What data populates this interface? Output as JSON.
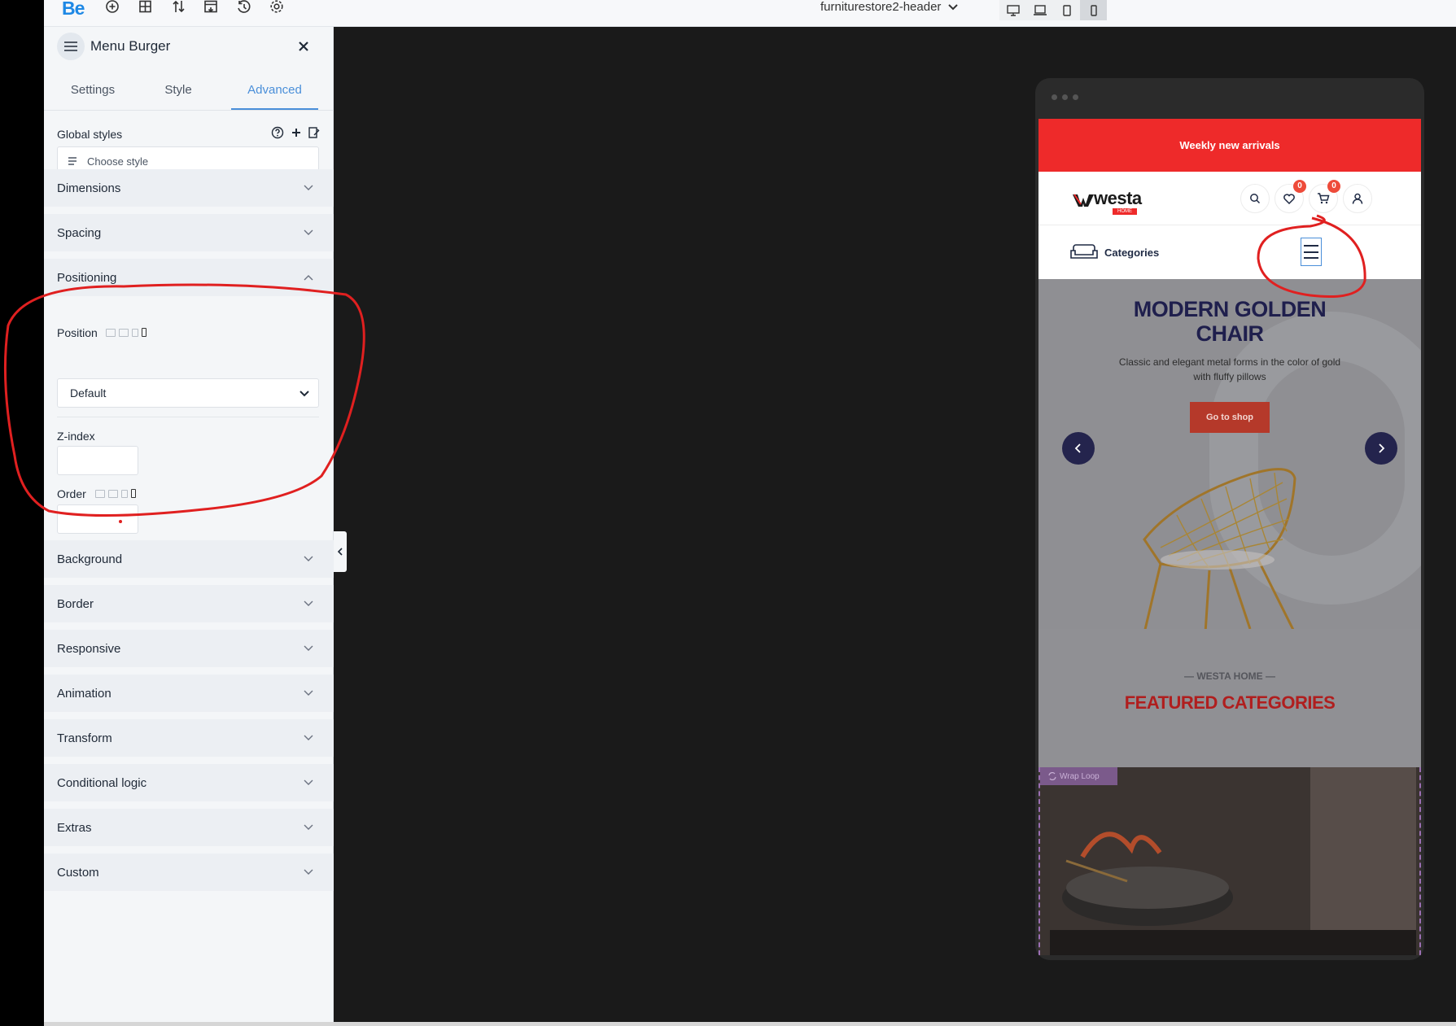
{
  "topbar": {
    "logo": "Be",
    "icons": [
      "plus-circle-icon",
      "layout-add-icon",
      "sort-icon",
      "template-icon",
      "history-icon",
      "gear-icon"
    ],
    "doc_title": "furniturestore2-header",
    "devices": [
      "desktop-icon",
      "laptop-icon",
      "tablet-icon",
      "mobile-icon"
    ],
    "active_device": "mobile"
  },
  "sidebar": {
    "title": "Menu Burger",
    "tabs": [
      "Settings",
      "Style",
      "Advanced"
    ],
    "active_tab": "Advanced",
    "global_styles": {
      "label": "Global styles",
      "placeholder": "Choose style"
    },
    "sections": {
      "dimensions": "Dimensions",
      "spacing": "Spacing",
      "positioning": "Positioning",
      "background": "Background",
      "border": "Border",
      "responsive": "Responsive",
      "animation": "Animation",
      "transform": "Transform",
      "conditional_logic": "Conditional logic",
      "extras": "Extras",
      "custom": "Custom"
    },
    "positioning": {
      "position_label": "Position",
      "position_value": "Default",
      "zindex_label": "Z-index",
      "zindex_value": "",
      "order_label": "Order",
      "order_value": ""
    }
  },
  "preview": {
    "announcement": "Weekly new arrivals",
    "brand": "westa",
    "brand_sub": "HOME",
    "wishlist_count": "0",
    "cart_count": "0",
    "categories_label": "Categories",
    "hero": {
      "title_line1": "MODERN GOLDEN",
      "title_line2": "CHAIR",
      "description": "Classic and elegant metal forms in the color of gold with fluffy pillows",
      "button": "Go to shop"
    },
    "featured": {
      "kicker": "— WESTA HOME —",
      "title": "FEATURED CATEGORIES"
    },
    "loop_tag": "Wrap Loop"
  },
  "colors": {
    "accent": "#4a8fd9",
    "announcement": "#ee2a2a",
    "annotation": "#e02020",
    "hero_title": "#1f1f4d",
    "featured_title": "#b01e1e"
  }
}
